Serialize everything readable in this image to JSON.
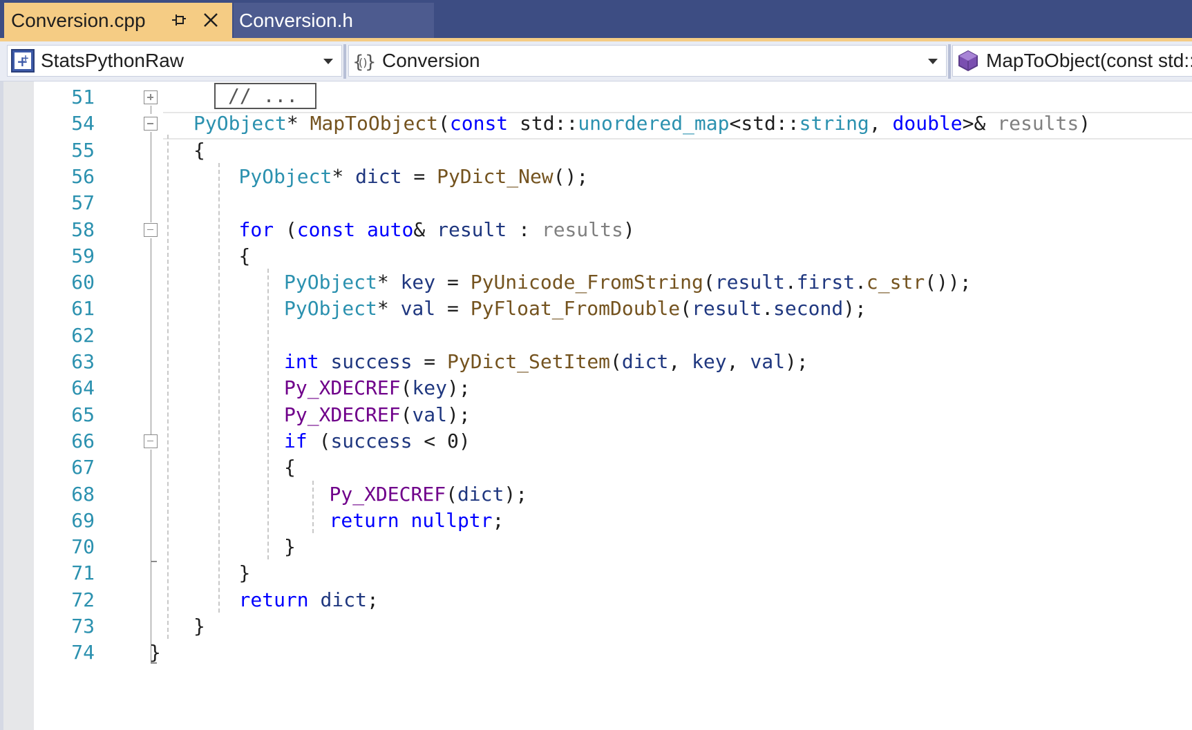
{
  "tabs": {
    "active_label": "Conversion.cpp",
    "inactive_label": "Conversion.h"
  },
  "nav": {
    "project": "StatsPythonRaw",
    "scope": "Conversion",
    "member": "MapToObject(const std::unordered_map<std::string, double>& results)"
  },
  "colors": {
    "tab_strip": "#3d4d83",
    "active_tab": "#f5cc84",
    "line_number": "#2b91af",
    "keyword": "#0000ff",
    "type": "#2b91af",
    "function": "#74531f"
  },
  "editor": {
    "lines": [
      {
        "num": "51",
        "tokens": [
          [
            "plain",
            ""
          ]
        ]
      },
      {
        "num": "54",
        "tokens": [
          [
            "type",
            "PyObject"
          ],
          [
            "plain",
            "* "
          ],
          [
            "fn",
            "MapToObject"
          ],
          [
            "plain",
            "("
          ],
          [
            "kw",
            "const"
          ],
          [
            "plain",
            " std::"
          ],
          [
            "type",
            "unordered_map"
          ],
          [
            "plain",
            "<std::"
          ],
          [
            "type",
            "string"
          ],
          [
            "plain",
            ", "
          ],
          [
            "kw",
            "double"
          ],
          [
            "plain",
            ">& "
          ],
          [
            "param",
            "results"
          ],
          [
            "plain",
            ")"
          ]
        ]
      },
      {
        "num": "55",
        "tokens": [
          [
            "plain",
            "{"
          ]
        ]
      },
      {
        "num": "56",
        "tokens": [
          [
            "type",
            "PyObject"
          ],
          [
            "plain",
            "* "
          ],
          [
            "var",
            "dict"
          ],
          [
            "plain",
            " = "
          ],
          [
            "fn",
            "PyDict_New"
          ],
          [
            "plain",
            "();"
          ]
        ]
      },
      {
        "num": "57",
        "tokens": [
          [
            "plain",
            ""
          ]
        ]
      },
      {
        "num": "58",
        "tokens": [
          [
            "kw",
            "for"
          ],
          [
            "plain",
            " ("
          ],
          [
            "kw",
            "const"
          ],
          [
            "plain",
            " "
          ],
          [
            "kw",
            "auto"
          ],
          [
            "plain",
            "& "
          ],
          [
            "var",
            "result"
          ],
          [
            "plain",
            " : "
          ],
          [
            "param",
            "results"
          ],
          [
            "plain",
            ")"
          ]
        ]
      },
      {
        "num": "59",
        "tokens": [
          [
            "plain",
            "{"
          ]
        ]
      },
      {
        "num": "60",
        "tokens": [
          [
            "type",
            "PyObject"
          ],
          [
            "plain",
            "* "
          ],
          [
            "var",
            "key"
          ],
          [
            "plain",
            " = "
          ],
          [
            "fn",
            "PyUnicode_FromString"
          ],
          [
            "plain",
            "("
          ],
          [
            "var",
            "result"
          ],
          [
            "plain",
            "."
          ],
          [
            "var",
            "first"
          ],
          [
            "plain",
            "."
          ],
          [
            "fn",
            "c_str"
          ],
          [
            "plain",
            "());"
          ]
        ]
      },
      {
        "num": "61",
        "tokens": [
          [
            "type",
            "PyObject"
          ],
          [
            "plain",
            "* "
          ],
          [
            "var",
            "val"
          ],
          [
            "plain",
            " = "
          ],
          [
            "fn",
            "PyFloat_FromDouble"
          ],
          [
            "plain",
            "("
          ],
          [
            "var",
            "result"
          ],
          [
            "plain",
            "."
          ],
          [
            "var",
            "second"
          ],
          [
            "plain",
            ");"
          ]
        ]
      },
      {
        "num": "62",
        "tokens": [
          [
            "plain",
            ""
          ]
        ]
      },
      {
        "num": "63",
        "tokens": [
          [
            "kw",
            "int"
          ],
          [
            "plain",
            " "
          ],
          [
            "var",
            "success"
          ],
          [
            "plain",
            " = "
          ],
          [
            "fn",
            "PyDict_SetItem"
          ],
          [
            "plain",
            "("
          ],
          [
            "var",
            "dict"
          ],
          [
            "plain",
            ", "
          ],
          [
            "var",
            "key"
          ],
          [
            "plain",
            ", "
          ],
          [
            "var",
            "val"
          ],
          [
            "plain",
            ");"
          ]
        ]
      },
      {
        "num": "64",
        "tokens": [
          [
            "macro",
            "Py_XDECREF"
          ],
          [
            "plain",
            "("
          ],
          [
            "var",
            "key"
          ],
          [
            "plain",
            ");"
          ]
        ]
      },
      {
        "num": "65",
        "tokens": [
          [
            "macro",
            "Py_XDECREF"
          ],
          [
            "plain",
            "("
          ],
          [
            "var",
            "val"
          ],
          [
            "plain",
            ");"
          ]
        ]
      },
      {
        "num": "66",
        "tokens": [
          [
            "kw",
            "if"
          ],
          [
            "plain",
            " ("
          ],
          [
            "var",
            "success"
          ],
          [
            "plain",
            " < 0)"
          ]
        ]
      },
      {
        "num": "67",
        "tokens": [
          [
            "plain",
            "{"
          ]
        ]
      },
      {
        "num": "68",
        "tokens": [
          [
            "macro",
            "Py_XDECREF"
          ],
          [
            "plain",
            "("
          ],
          [
            "var",
            "dict"
          ],
          [
            "plain",
            ");"
          ]
        ]
      },
      {
        "num": "69",
        "tokens": [
          [
            "kw",
            "return"
          ],
          [
            "plain",
            " "
          ],
          [
            "kw",
            "nullptr"
          ],
          [
            "plain",
            ";"
          ]
        ]
      },
      {
        "num": "70",
        "tokens": [
          [
            "plain",
            "}"
          ]
        ]
      },
      {
        "num": "71",
        "tokens": [
          [
            "plain",
            "}"
          ]
        ]
      },
      {
        "num": "72",
        "tokens": [
          [
            "kw",
            "return"
          ],
          [
            "plain",
            " "
          ],
          [
            "var",
            "dict"
          ],
          [
            "plain",
            ";"
          ]
        ]
      },
      {
        "num": "73",
        "tokens": [
          [
            "plain",
            "}"
          ]
        ]
      },
      {
        "num": "74",
        "tokens": [
          [
            "plain",
            "}"
          ]
        ]
      }
    ],
    "collapsed_text": "// ..."
  }
}
